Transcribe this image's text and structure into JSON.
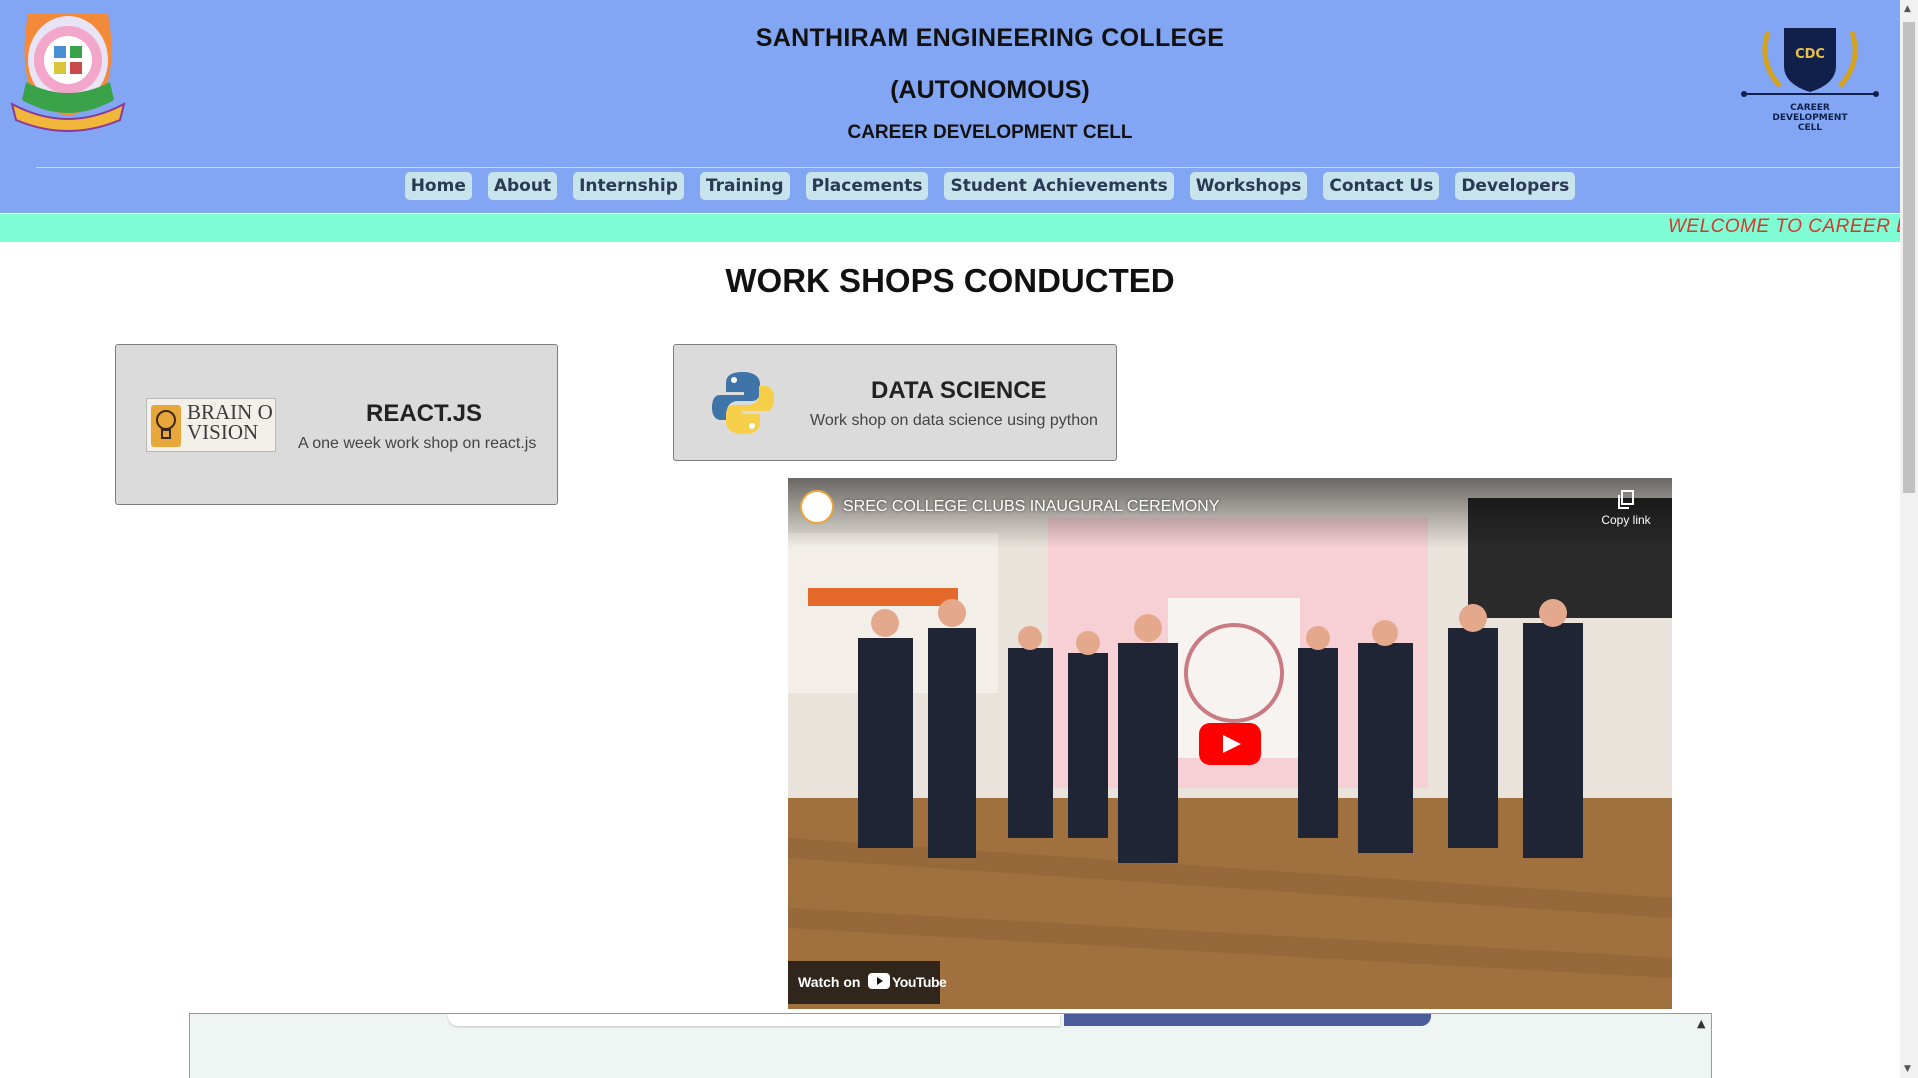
{
  "header": {
    "title_line1": "SANTHIRAM ENGINEERING COLLEGE",
    "title_line2": "(AUTONOMOUS)",
    "title_line3": "CAREER DEVELOPMENT CELL",
    "right_logo_text": "CDC",
    "right_logo_caption": [
      "CAREER",
      "DEVELOPMENT",
      "CELL"
    ]
  },
  "nav": {
    "items": [
      "Home",
      "About",
      "Internship",
      "Training",
      "Placements",
      "Student Achievements",
      "Workshops",
      "Contact Us",
      "Developers"
    ]
  },
  "marquee": {
    "text": "WELCOME TO CAREER DE"
  },
  "main": {
    "section_title": "WORK SHOPS CONDUCTED",
    "cards": [
      {
        "title": "REACT.JS",
        "description": "A one week work shop on react.js",
        "logo_text": [
          "BRAIN O",
          "VISION"
        ]
      },
      {
        "title": "DATA SCIENCE",
        "description": "Work shop on data science using python"
      }
    ]
  },
  "video": {
    "title": "SREC COLLEGE CLUBS INAUGURAL CEREMONY",
    "copy_link_label": "Copy link",
    "watch_on_label": "Watch on",
    "youtube_label": "YouTube"
  },
  "colors": {
    "header_bg": "#82a6f3",
    "marquee_bg": "#7ffed6",
    "marquee_text": "#d23a2a",
    "nav_button": "#c7e3ec",
    "card_bg": "#dbdbdb",
    "youtube_red": "#ff0000"
  }
}
